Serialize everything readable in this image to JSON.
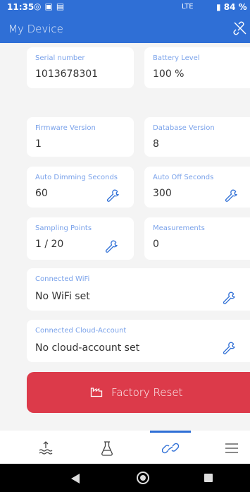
{
  "status_bar": {
    "time": "11:35",
    "network": "LTE",
    "battery": "84 %"
  },
  "app_bar": {
    "title": "My Device"
  },
  "cards": {
    "serial": {
      "label": "Serial number",
      "value": "1013678301"
    },
    "battery": {
      "label": "Battery Level",
      "value": "100 %"
    },
    "firmware": {
      "label": "Firmware Version",
      "value": "1"
    },
    "database": {
      "label": "Database Version",
      "value": "8"
    },
    "dimming": {
      "label": "Auto Dimming Seconds",
      "value": "60"
    },
    "auto_off": {
      "label": "Auto Off Seconds",
      "value": "300"
    },
    "sampling": {
      "label": "Sampling Points",
      "value": "1 / 20"
    },
    "measurements": {
      "label": "Measurements",
      "value": "0"
    },
    "wifi": {
      "label": "Connected WiFi",
      "value": "No WiFi set"
    },
    "cloud": {
      "label": "Connected Cloud-Account",
      "value": "No cloud-account set"
    }
  },
  "factory_reset": {
    "label": "Factory Reset"
  },
  "colors": {
    "primary": "#2f6fd6",
    "danger": "#dc3a4a",
    "label": "#7aa2ea"
  },
  "bottom_nav": {
    "active": "device-link",
    "items": [
      "measure",
      "lab",
      "device-link",
      "menu"
    ]
  }
}
